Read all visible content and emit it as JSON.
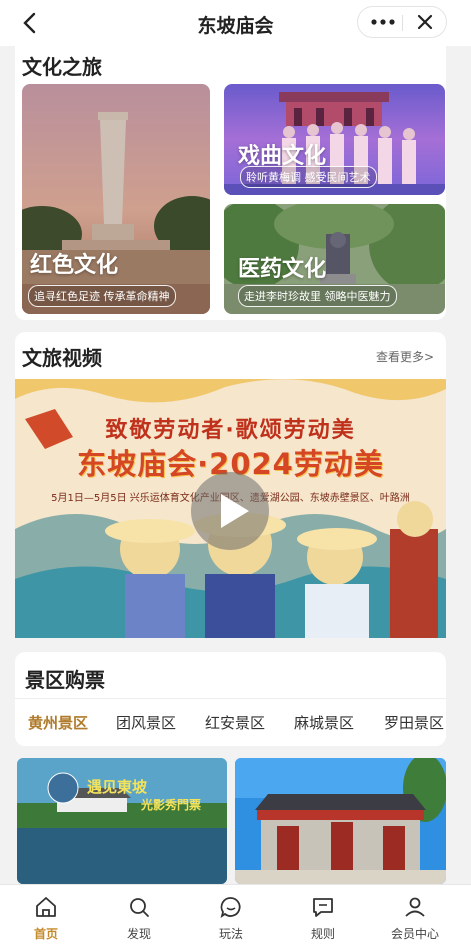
{
  "header": {
    "title": "东坡庙会"
  },
  "culture": {
    "title": "文化之旅",
    "tiles": [
      {
        "title": "红色文化",
        "subtitle": "追寻红色足迹 传承革命精神"
      },
      {
        "title": "戏曲文化",
        "subtitle": "聆听黄梅调 感受民间艺术"
      },
      {
        "title": "医药文化",
        "subtitle": "走进李时珍故里 领略中医魅力"
      }
    ]
  },
  "video": {
    "title": "文旅视频",
    "more": "查看更多>",
    "banner_line1": "致敬劳动者·歌颂劳动美",
    "banner_line2": "东坡庙会·2024劳动美",
    "banner_line3": "5月1日—5月5日  兴乐运体育文化产业园区、遗爱湖公园、东坡赤壁景区、叶路洲"
  },
  "tickets": {
    "title": "景区购票",
    "tabs": [
      "黄州景区",
      "团风景区",
      "红安景区",
      "麻城景区",
      "罗田景区"
    ],
    "active_tab": 0,
    "thumb1_caption": "遇见東坡",
    "thumb1_caption2": "光影秀門票"
  },
  "nav": {
    "items": [
      {
        "label": "首页",
        "icon": "home-icon"
      },
      {
        "label": "发现",
        "icon": "search-icon"
      },
      {
        "label": "玩法",
        "icon": "chat-icon"
      },
      {
        "label": "规则",
        "icon": "message-icon"
      },
      {
        "label": "会员中心",
        "icon": "user-icon"
      }
    ],
    "active": 0
  },
  "colors": {
    "accent": "#c48a2c",
    "active_tab": "#b07b2a"
  }
}
